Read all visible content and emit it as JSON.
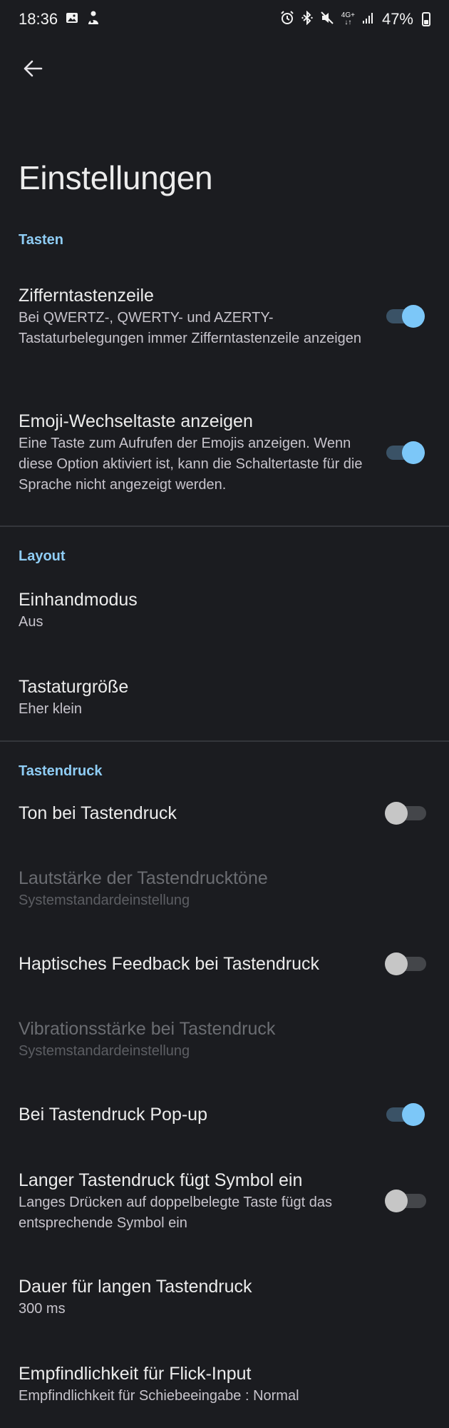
{
  "status_bar": {
    "time": "18:36",
    "battery": "47%",
    "network": "4G+",
    "left_icons": [
      "gallery-icon",
      "app-notification-icon"
    ],
    "right_icons": [
      "alarm-icon",
      "bluetooth-icon",
      "mute-icon",
      "network-icon",
      "signal-icon",
      "battery-icon"
    ]
  },
  "app_bar": {
    "back_icon": "arrow-left-icon"
  },
  "page_title": "Einstellungen",
  "sections": {
    "keys": {
      "header": "Tasten",
      "number_row": {
        "title": "Zifferntastenzeile",
        "summary": "Bei QWERTZ-, QWERTY- und AZERTY-Tastaturbelegungen immer Zifferntastenzeile anzeigen",
        "enabled": true
      },
      "emoji_key": {
        "title": "Emoji-Wechseltaste anzeigen",
        "summary": "Eine Taste zum Aufrufen der Emojis anzeigen. Wenn diese Option aktiviert ist, kann die Schaltertaste für die Sprache nicht angezeigt werden.",
        "enabled": true
      }
    },
    "layout": {
      "header": "Layout",
      "one_hand": {
        "title": "Einhandmodus",
        "summary": "Aus"
      },
      "keyboard_size": {
        "title": "Tastaturgröße",
        "summary": "Eher klein"
      }
    },
    "keypress": {
      "header": "Tastendruck",
      "sound": {
        "title": "Ton bei Tastendruck",
        "enabled": false
      },
      "volume": {
        "title": "Lautstärke der Tastendrucktöne",
        "summary": "Systemstandardeinstellung",
        "disabled": true
      },
      "haptic": {
        "title": "Haptisches Feedback bei Tastendruck",
        "enabled": false
      },
      "vibration": {
        "title": "Vibrationsstärke bei Tastendruck",
        "summary": "Systemstandardeinstellung",
        "disabled": true
      },
      "popup": {
        "title": "Bei Tastendruck Pop-up",
        "enabled": true
      },
      "long_press_symbol": {
        "title": "Langer Tastendruck fügt Symbol ein",
        "summary": "Langes Drücken auf doppelbelegte Taste fügt das entsprechende Symbol ein",
        "enabled": false
      },
      "long_press_duration": {
        "title": "Dauer für langen Tastendruck",
        "summary": "300 ms"
      },
      "flick_sensitivity": {
        "title": "Empfindlichkeit für Flick-Input",
        "summary": "Empfindlichkeit für Schiebeeingabe : Normal"
      }
    }
  },
  "colors": {
    "background": "#1b1c20",
    "accent": "#8fcdf5",
    "toggle_on_thumb": "#7cc7f8",
    "toggle_on_track": "#3a5266",
    "toggle_off_thumb": "#c6c6c6",
    "toggle_off_track": "#44464a",
    "divider": "#34363b"
  }
}
